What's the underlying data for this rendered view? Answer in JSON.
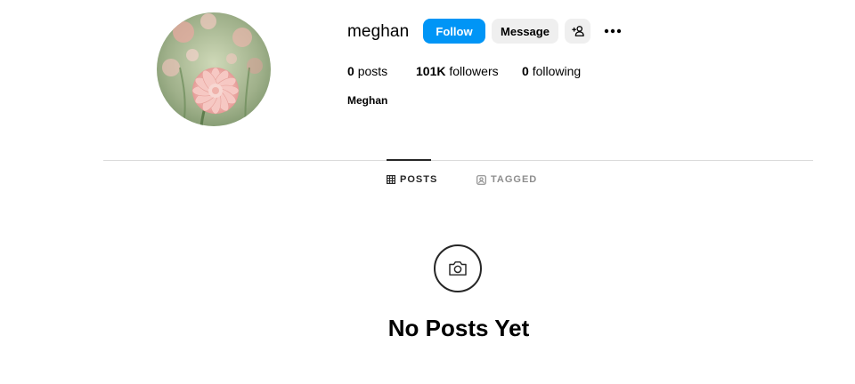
{
  "profile": {
    "username": "meghan",
    "full_name": "Meghan",
    "avatar_icon": "flower-photo"
  },
  "actions": {
    "follow_label": "Follow",
    "message_label": "Message",
    "suggest_icon": "add-person-icon",
    "more_icon": "more-options-icon",
    "follow_color": "#0095f6",
    "secondary_color": "#efefef"
  },
  "stats": {
    "posts_count": "0",
    "posts_label": "posts",
    "followers_count": "101K",
    "followers_label": "followers",
    "following_count": "0",
    "following_label": "following"
  },
  "tabs": [
    {
      "label": "POSTS",
      "icon": "grid-icon",
      "active": true
    },
    {
      "label": "TAGGED",
      "icon": "tagged-icon",
      "active": false
    }
  ],
  "empty_state": {
    "icon": "camera-icon",
    "title": "No Posts Yet"
  }
}
